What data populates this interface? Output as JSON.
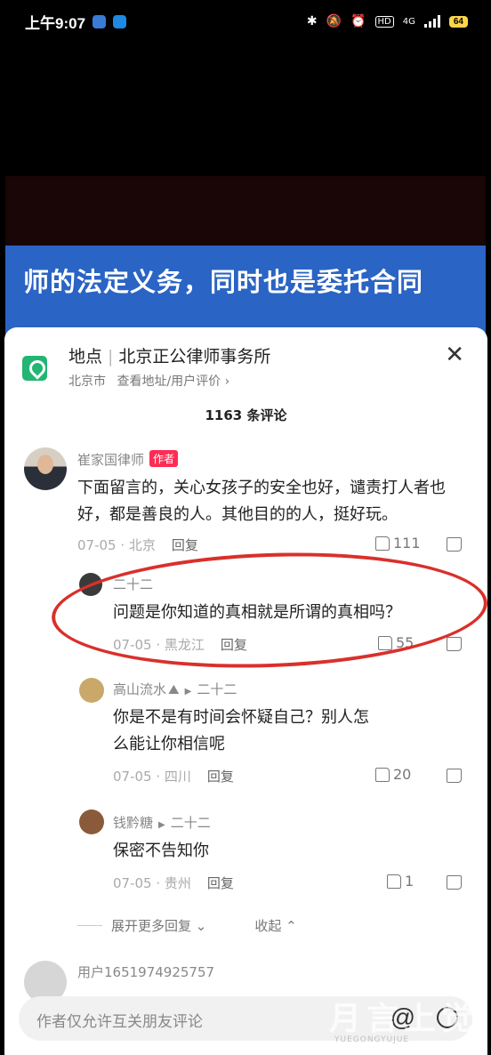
{
  "status_bar": {
    "time": "上午9:07",
    "network": "4G",
    "battery": "64"
  },
  "video": {
    "caption": "师的法定义务，同时也是委托合同"
  },
  "location": {
    "label": "地点",
    "name": "北京正公律师事务所",
    "city": "北京市",
    "link": "查看地址/用户评价 ›"
  },
  "comments_count": "1163 条评论",
  "comments": [
    {
      "author": "崔家国律师",
      "badge": "作者",
      "text": "下面留言的，关心女孩子的安全也好，谴责打人者也好，都是善良的人。其他目的的人，挺好玩。",
      "date": "07-05",
      "region": "北京",
      "reply_label": "回复",
      "likes": "111"
    }
  ],
  "replies": [
    {
      "author": "二十二",
      "text": "问题是你知道的真相就是所谓的真相吗？",
      "date": "07-05",
      "region": "黑龙江",
      "reply_label": "回复",
      "likes": "55"
    },
    {
      "author": "高山流水",
      "reply_to": "二十二",
      "text": "你是不是有时间会怀疑自己？别人怎么能让你相信呢",
      "date": "07-05",
      "region": "四川",
      "reply_label": "回复",
      "likes": "20"
    },
    {
      "author": "钱黔糖",
      "reply_to": "二十二",
      "text": "保密不告知你",
      "date": "07-05",
      "region": "贵州",
      "reply_label": "回复",
      "likes": "1"
    }
  ],
  "expand_more": "展开更多回复 ⌄",
  "collapse": "收起 ⌃",
  "next_comment_author": "用户1651974925757",
  "input": {
    "placeholder": "作者仅允许互关朋友评论"
  },
  "watermark": "月言上觉",
  "watermark_sub": "YUEGONGYUJUE"
}
